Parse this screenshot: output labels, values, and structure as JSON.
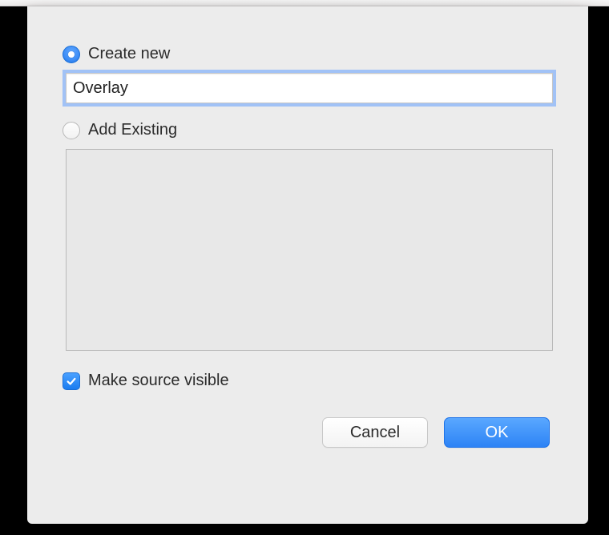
{
  "options": {
    "create_new_label": "Create new",
    "create_new_selected": true,
    "add_existing_label": "Add Existing",
    "add_existing_selected": false
  },
  "name_input": {
    "value": "Overlay",
    "placeholder": ""
  },
  "existing_list": {
    "items": []
  },
  "make_visible": {
    "label": "Make source visible",
    "checked": true
  },
  "buttons": {
    "cancel": "Cancel",
    "ok": "OK"
  }
}
